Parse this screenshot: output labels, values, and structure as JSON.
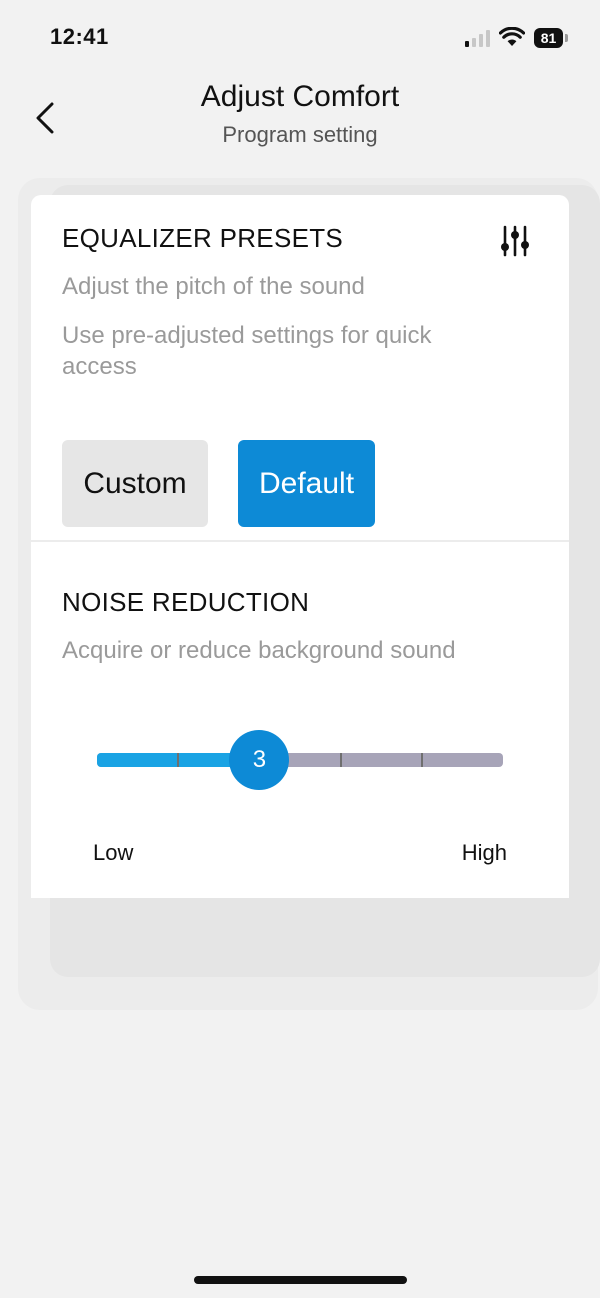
{
  "status_bar": {
    "time": "12:41",
    "battery_level": "81",
    "signal_bars_active": 1,
    "signal_bars_total": 4
  },
  "header": {
    "title": "Adjust Comfort",
    "subtitle": "Program setting",
    "back_icon": "chevron-left-icon"
  },
  "equalizer": {
    "title": "EQUALIZER PRESETS",
    "settings_icon": "sliders-icon",
    "description": "Adjust the pitch of the sound",
    "hint": "Use pre-adjusted settings for quick access",
    "presets": [
      {
        "label": "Custom",
        "selected": false
      },
      {
        "label": "Default",
        "selected": true
      }
    ]
  },
  "noise_reduction": {
    "title": "NOISE REDUCTION",
    "description": "Acquire or reduce background sound",
    "slider": {
      "value": 3,
      "min": 1,
      "max": 6,
      "min_label": "Low",
      "max_label": "High"
    }
  },
  "colors": {
    "accent": "#0d8ad6",
    "slider_fill": "#1aa3e4",
    "slider_track": "#a7a4b8",
    "background": "#f2f2f2"
  }
}
